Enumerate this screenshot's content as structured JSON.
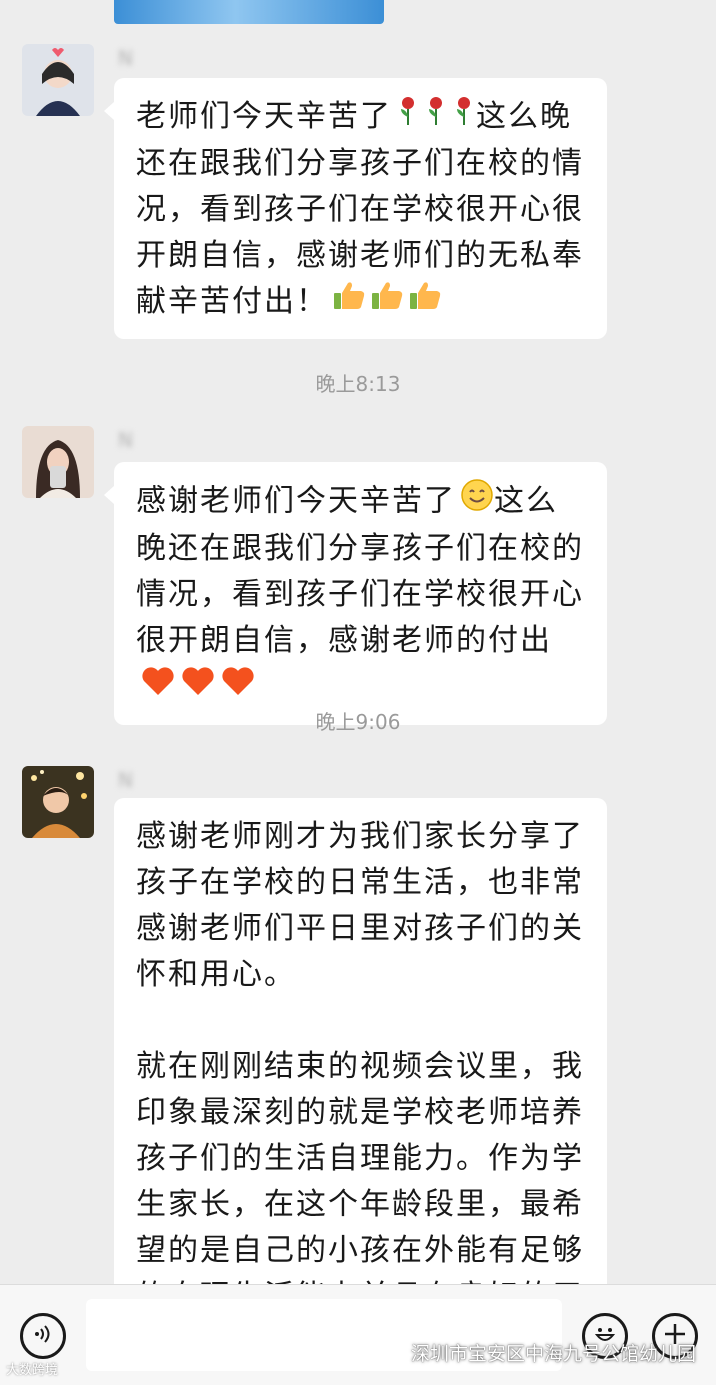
{
  "chat": {
    "messages": [
      {
        "sender": "N",
        "paragraphs": [
          "老师们今天辛苦了🌹🌹🌹这么晚还在跟我们分享孩子们在校的情况，看到孩子们在学校很开心很开朗自信，感谢老师们的无私奉献辛苦付出！👍👍👍"
        ],
        "line_text": [
          "老师们今天辛苦了",
          "这么晚",
          "还在跟我们分享孩子们在校的情",
          "况，看到孩子们在学校很开心很开",
          "朗自信，感谢老师们的无私奉献辛",
          "苦付出！"
        ],
        "emoji_rose": "🌹",
        "emoji_thumb": "👍"
      },
      {
        "time": "晚上8:13"
      },
      {
        "sender": "N",
        "line_text": [
          "感谢老师们今天辛苦了",
          "这么晚",
          "还在跟我们分享孩子们在校的情",
          "况，看到孩子们在学校很开心很开",
          "朗自信，感谢老师的付出"
        ],
        "emoji_smile": "😊",
        "emoji_heart": "🧡"
      },
      {
        "time": "晚上9:06"
      },
      {
        "sender": "N",
        "paragraph1": "感谢老师刚才为我们家长分享了孩子在学校的日常生活，也非常感谢老师们平日里对孩子们的关怀和用心。",
        "paragraph2": "就在刚刚结束的视频会议里，我印象最深刻的就是学校老师培养孩子们的生活自理能力。作为学生家长，在这个年龄段里，最希望的是自己的小孩在外能有足够的自理生活能力并且有良好的习惯，感谢学"
      }
    ]
  },
  "time1": "晚上8:13",
  "time2": "晚上9:06",
  "sender1": "N",
  "sender2": "N",
  "sender3": "N",
  "watermark_left": "大数跨境",
  "watermark_right": "深圳市宝安区中海九号公馆幼儿园",
  "icons": {
    "voice": "voice-icon",
    "emoji": "emoji-icon",
    "plus": "plus-icon"
  },
  "colors": {
    "background": "#ededed",
    "bubble": "#ffffff",
    "text": "#191919",
    "timestamp": "#9a9a9a"
  }
}
